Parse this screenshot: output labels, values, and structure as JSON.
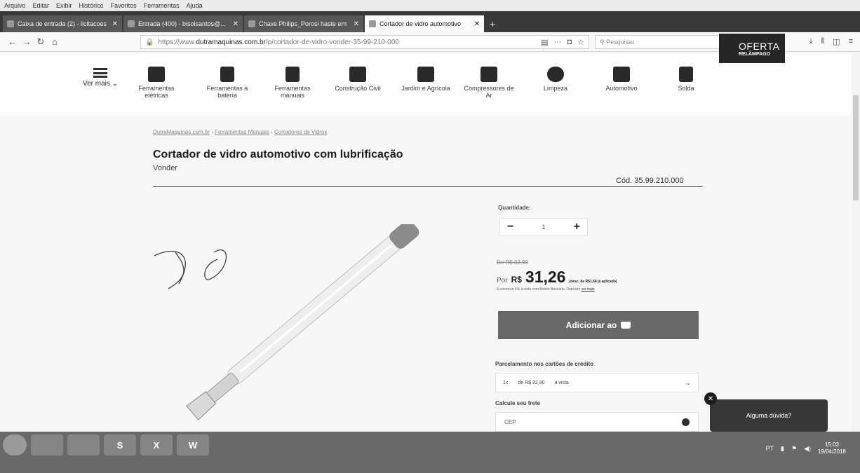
{
  "menu": [
    "Arquivo",
    "Editar",
    "Exibir",
    "Histórico",
    "Favoritos",
    "Ferramentas",
    "Ajuda"
  ],
  "tabs": [
    {
      "title": "Caixa de entrada (2) - licitacoes",
      "active": false
    },
    {
      "title": "Entrada (400) - bisolsantos@...",
      "active": false
    },
    {
      "title": "Chave Philips_Porosi haste em",
      "active": false
    },
    {
      "title": "Cortador de vidro automotivo",
      "active": true
    }
  ],
  "nav": {
    "url_prefix": "https://www.",
    "url_domain": "dutramaquinas.com.br",
    "url_path": "/p/cortador-de-vidro-vonder-35-99-210-000",
    "search_placeholder": "Pesquisar"
  },
  "header": {
    "ver_mais": "Ver mais",
    "categories": [
      {
        "label": "Ferramentas elétricas",
        "icon": "drill-icon"
      },
      {
        "label": "Ferramentas à bateria",
        "icon": "battery-drill-icon"
      },
      {
        "label": "Ferramentas manuais",
        "icon": "hand-tools-icon"
      },
      {
        "label": "Construção Civil",
        "icon": "bricks-icon"
      },
      {
        "label": "Jardim e Agrícola",
        "icon": "lawnmower-icon"
      },
      {
        "label": "Compressores de Ar",
        "icon": "compressor-icon"
      },
      {
        "label": "Limpeza",
        "icon": "bucket-icon"
      },
      {
        "label": "Automotivo",
        "icon": "car-seat-icon"
      },
      {
        "label": "Solda",
        "icon": "welding-mask-icon"
      }
    ],
    "oferta_title": "OFERTA",
    "oferta_sub": "RELÂMPAGO"
  },
  "product": {
    "breadcrumb": [
      "DutraMaquinas.com.br",
      "Ferramentas Manuais",
      "Cortadores de Vidros"
    ],
    "title": "Cortador de vidro automotivo com lubrificação",
    "brand": "Vonder",
    "code": "Cód. 35.99.210.000",
    "quantity_label": "Quantidade:",
    "quantity": "1",
    "old_price": "De R$ 32,90",
    "por": "Por",
    "currency": "R$",
    "price": "31,26",
    "discount_note": "(desc. de R$1,64 já aplicado)",
    "economy_note": "Economize 5% à vista com Boleto Bancário, Depósito",
    "ver_mais": "ver mais",
    "add_button": "Adicionar ao",
    "installments_label": "Parcelamento nos cartões de crédito",
    "installment_count": "1x",
    "installment_value": "de R$ 32,90",
    "installment_type": "à vista",
    "frete_label": "Calcule seu frete",
    "cep_placeholder": "CEP"
  },
  "chat": {
    "label": "Alguma dúvida?"
  },
  "taskbar": {
    "apps": [
      "",
      "",
      "",
      "S",
      "X",
      "W"
    ],
    "lang": "PT",
    "time": "15:03",
    "date": "19/04/2018"
  }
}
